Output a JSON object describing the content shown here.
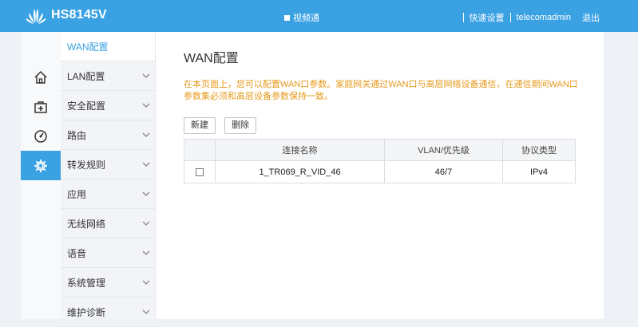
{
  "header": {
    "brand": "HS8145V",
    "center_link": "视频通",
    "quick_setup": "快速设置",
    "username": "telecomadmin",
    "logout": "退出"
  },
  "sidebar": {
    "icons": [
      {
        "name": "home-icon",
        "active": false
      },
      {
        "name": "first-aid-icon",
        "active": false
      },
      {
        "name": "gauge-icon",
        "active": false
      },
      {
        "name": "gear-icon",
        "active": true
      }
    ],
    "items": [
      {
        "label": "WAN配置",
        "active": true
      },
      {
        "label": "LAN配置"
      },
      {
        "label": "安全配置"
      },
      {
        "label": "路由"
      },
      {
        "label": "转发规则"
      },
      {
        "label": "应用"
      },
      {
        "label": "无线网络"
      },
      {
        "label": "语音"
      },
      {
        "label": "系统管理"
      },
      {
        "label": "维护诊断"
      }
    ]
  },
  "main": {
    "title": "WAN配置",
    "description": "在本页面上，您可以配置WAN口参数。家庭网关通过WAN口与高层网络设备通信，在通信期间WAN口参数集必须和高层设备参数保持一致。",
    "buttons": {
      "new": "新建",
      "delete": "删除"
    },
    "table": {
      "headers": [
        "",
        "连接名称",
        "VLAN/优先级",
        "协议类型"
      ],
      "rows": [
        {
          "name": "1_TR069_R_VID_46",
          "vlan": "46/7",
          "protocol": "IPv4"
        }
      ]
    }
  },
  "colors": {
    "accent": "#3aa1e3",
    "warning_text": "#e69a1c"
  }
}
